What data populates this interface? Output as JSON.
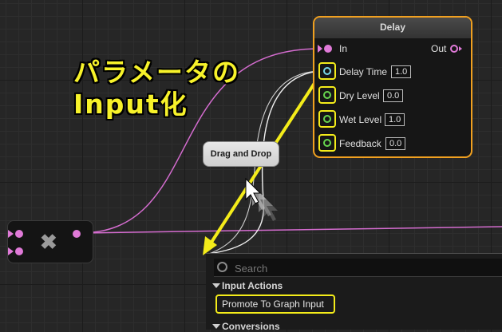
{
  "overlay": {
    "line1": "パラメータの",
    "line2": "Input化"
  },
  "delay_node": {
    "title": "Delay",
    "in_label": "In",
    "out_label": "Out",
    "params": [
      {
        "label": "Delay Time",
        "value": "1.0"
      },
      {
        "label": "Dry Level",
        "value": "0.0"
      },
      {
        "label": "Wet Level",
        "value": "1.0"
      },
      {
        "label": "Feedback",
        "value": "0.0"
      }
    ]
  },
  "tooltip": {
    "text": "Drag and Drop"
  },
  "multiply_node": {
    "symbol": "✖"
  },
  "context_menu": {
    "search_placeholder": "Search",
    "categories": [
      {
        "label": "Input Actions"
      },
      {
        "label": "Conversions"
      }
    ],
    "items": [
      {
        "label": "Promote To Graph Input"
      }
    ]
  },
  "colors": {
    "audio_wire": "#e07ad8",
    "float_pin": "#67d64f",
    "highlight": "#f4ec1a",
    "node_selected_border": "#f0a020"
  }
}
